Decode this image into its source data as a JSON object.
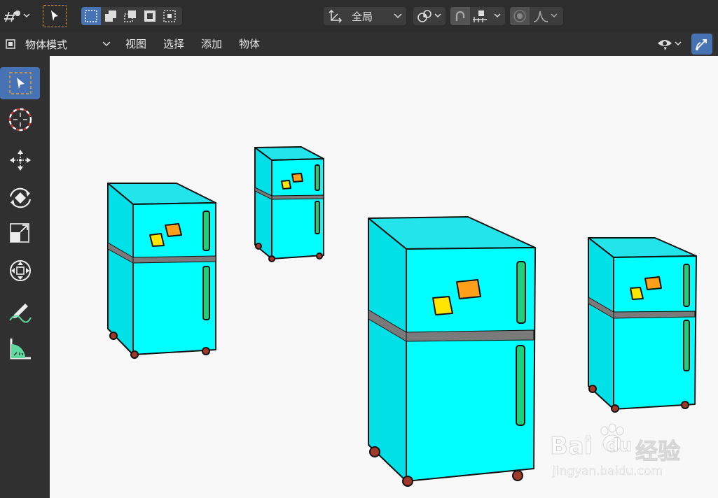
{
  "topbar": {
    "orientation_label": "全局",
    "icons": [
      "transform-pivot-icon",
      "select-mode-icon",
      "box-select-new-icon",
      "select-extend-icon",
      "select-subtract-icon",
      "select-invert-icon",
      "select-intersect-icon",
      "transform-orientation-icon",
      "pivot-point-icon",
      "snap-icon",
      "snap-target-icon",
      "proportional-edit-icon",
      "falloff-icon"
    ]
  },
  "header": {
    "mode_label": "物体模式",
    "menus": [
      "视图",
      "选择",
      "添加",
      "物体"
    ]
  },
  "toolbar": {
    "tools": [
      "select-box-icon",
      "cursor-icon",
      "move-icon",
      "rotate-icon",
      "scale-icon",
      "transform-icon",
      "annotate-icon",
      "measure-icon"
    ]
  },
  "watermark": {
    "brand": "Bai",
    "brand2": "du",
    "cn": "经验",
    "url": "jingyan.baidu.com"
  },
  "colors": {
    "accent": "#4772b3",
    "fridge_body": "#00ffff",
    "handle": "#1fd07a",
    "note_yellow": "#ffe600",
    "note_orange": "#ff9f1a"
  }
}
